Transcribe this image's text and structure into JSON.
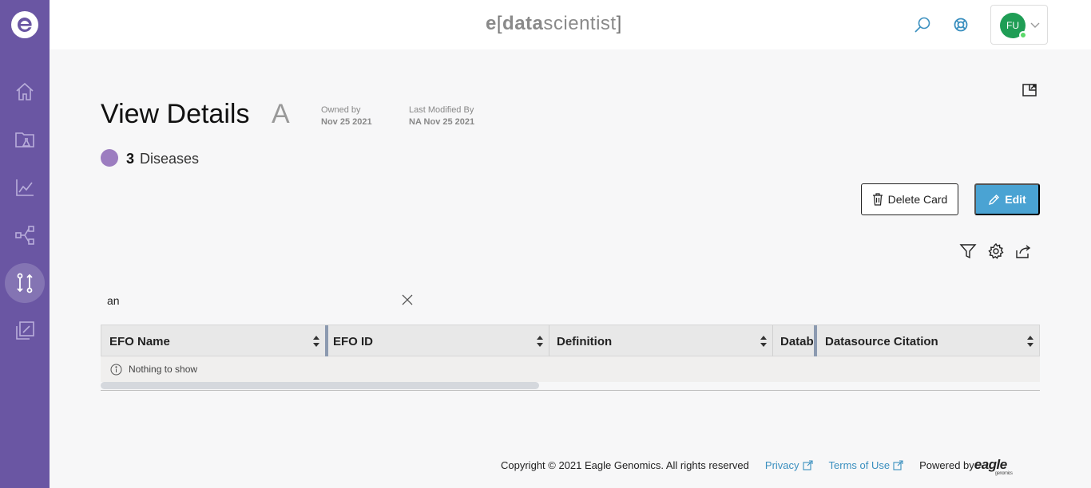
{
  "header": {
    "brand_e": "e",
    "brand_open": "[",
    "brand_data": "data",
    "brand_scientist": "scientist",
    "brand_close": "]",
    "user_initials": "FU"
  },
  "page": {
    "title": "View Details",
    "title_letter": "A",
    "owned_by_label": "Owned by",
    "owned_by_value": "Nov 25 2021",
    "last_modified_label": "Last Modified By",
    "last_modified_value": "NA Nov 25 2021",
    "disease_count": "3",
    "disease_label": "Diseases"
  },
  "actions": {
    "delete_label": "Delete Card",
    "edit_label": "Edit"
  },
  "search": {
    "value": "an",
    "placeholder": ""
  },
  "table": {
    "columns": [
      "EFO Name",
      "EFO ID",
      "Definition",
      "Datab",
      "Datasource Citation"
    ],
    "empty_message": "Nothing to show"
  },
  "footer": {
    "copyright": "Copyright © 2021 Eagle Genomics. All rights reserved",
    "privacy": "Privacy",
    "terms": "Terms of Use",
    "powered_by": "Powered by",
    "eagle_logo": "eagle",
    "eagle_sub": "genomics"
  },
  "colors": {
    "sidebar": "#6a56a3",
    "accent": "#4aa3d3",
    "disease_dot": "#9c7dc0",
    "avatar": "#1f9d55"
  }
}
